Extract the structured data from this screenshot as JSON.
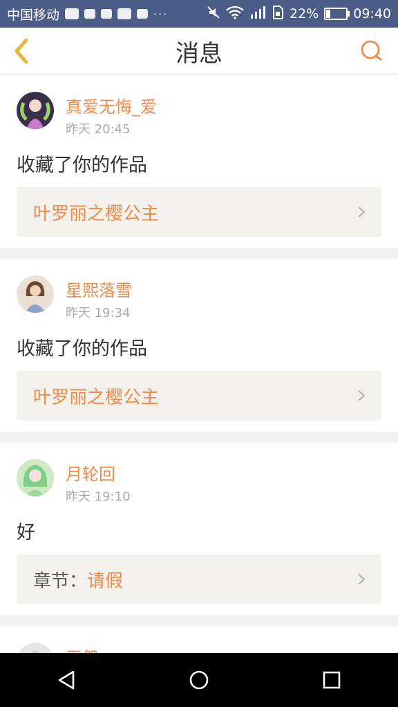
{
  "status_bar": {
    "carrier": "中国移动",
    "dots": "···",
    "battery_text": "22%",
    "battery_level": 0.22,
    "time": "09:40"
  },
  "header": {
    "title": "消息",
    "back_icon": "chevron-left-icon",
    "search_icon": "search-icon"
  },
  "colors": {
    "accent": "#f08b4a",
    "status_bar": "#4b5d86"
  },
  "messages": [
    {
      "username": "真爱无悔_爱",
      "time": "昨天 20:45",
      "content": "收藏了你的作品",
      "work_prefix": "",
      "work_title": "叶罗丽之樱公主"
    },
    {
      "username": "星熙落雪",
      "time": "昨天 19:34",
      "content": "收藏了你的作品",
      "work_prefix": "",
      "work_title": "叶罗丽之樱公主"
    },
    {
      "username": "月轮回",
      "time": "昨天 19:10",
      "content": "好",
      "work_prefix": "章节：",
      "work_title": "请假"
    },
    {
      "username": "无怨"
    }
  ],
  "nav": {
    "back": "triangle-back-icon",
    "home": "circle-home-icon",
    "recent": "square-recent-icon"
  }
}
